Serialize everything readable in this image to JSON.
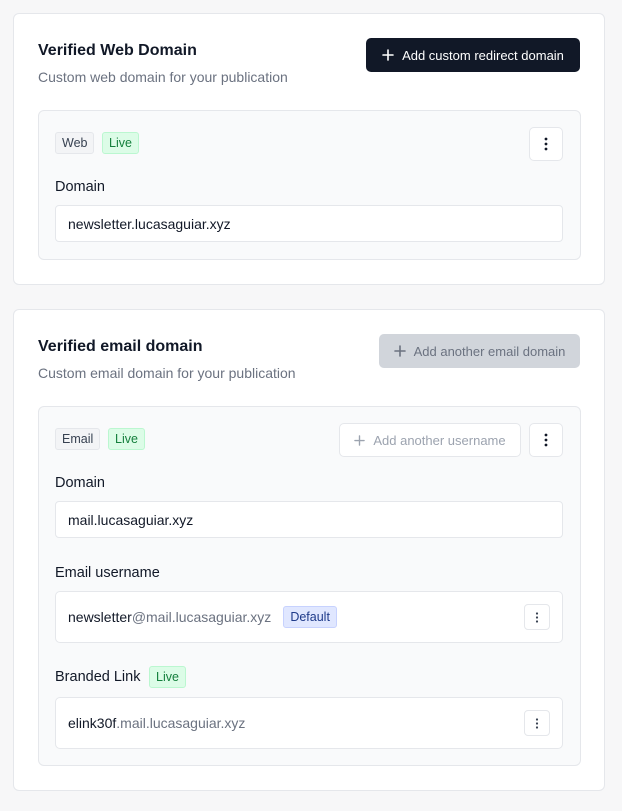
{
  "web_section": {
    "title": "Verified Web Domain",
    "subtitle": "Custom web domain for your publication",
    "add_button_label": "Add custom redirect domain",
    "badge_type": "Web",
    "badge_status": "Live",
    "domain_label": "Domain",
    "domain_value": "newsletter.lucasaguiar.xyz"
  },
  "email_section": {
    "title": "Verified email domain",
    "subtitle": "Custom email domain for your publication",
    "add_button_label": "Add another email domain",
    "badge_type": "Email",
    "badge_status": "Live",
    "add_username_label": "Add another username",
    "domain_label": "Domain",
    "domain_value": "mail.lucasaguiar.xyz",
    "username_label": "Email username",
    "username_local": "newsletter",
    "username_domain": "@mail.lucasaguiar.xyz",
    "username_badge": "Default",
    "branded_label": "Branded Link",
    "branded_status": "Live",
    "branded_prefix": "elink30f",
    "branded_domain": ".mail.lucasaguiar.xyz"
  },
  "icons": {
    "plus": "plus-icon",
    "more": "more-vertical-icon"
  },
  "colors": {
    "primary_button": "#111827",
    "live_badge_bg": "#dcfce7",
    "live_badge_text": "#15803d",
    "default_badge_bg": "#e0e7ff"
  }
}
